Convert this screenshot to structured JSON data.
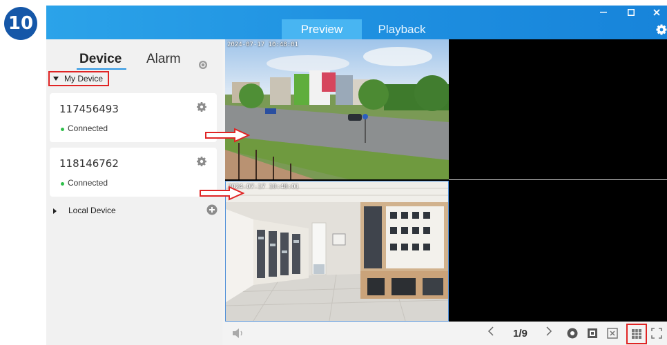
{
  "step": {
    "number": "10"
  },
  "titlebar": {
    "tabs": [
      {
        "label": "Preview",
        "active": true
      },
      {
        "label": "Playback",
        "active": false
      }
    ]
  },
  "sidebar": {
    "tabs": {
      "device": "Device",
      "alarm": "Alarm"
    },
    "my_device_label": "My Device",
    "devices": [
      {
        "id": "117456493",
        "status": "Connected"
      },
      {
        "id": "118146762",
        "status": "Connected"
      }
    ],
    "local_device_label": "Local Device"
  },
  "preview": {
    "cameras": [
      {
        "timestamp": "2024-07-17 10:48:01"
      },
      {
        "timestamp": "2024-07-17 10:48:01"
      }
    ]
  },
  "bottombar": {
    "page": "1/9"
  },
  "colors": {
    "accent": "#1e8fe0",
    "highlight": "#e02424",
    "online": "#2fbf4a"
  },
  "icons": [
    "minimize-icon",
    "maximize-icon",
    "close-icon",
    "settings-gear-icon",
    "refresh-icon",
    "gear-icon",
    "add-icon",
    "speaker-icon",
    "chevron-left-icon",
    "chevron-right-icon",
    "record-icon",
    "snapshot-icon",
    "close-all-icon",
    "layout-grid-icon",
    "fullscreen-icon"
  ]
}
